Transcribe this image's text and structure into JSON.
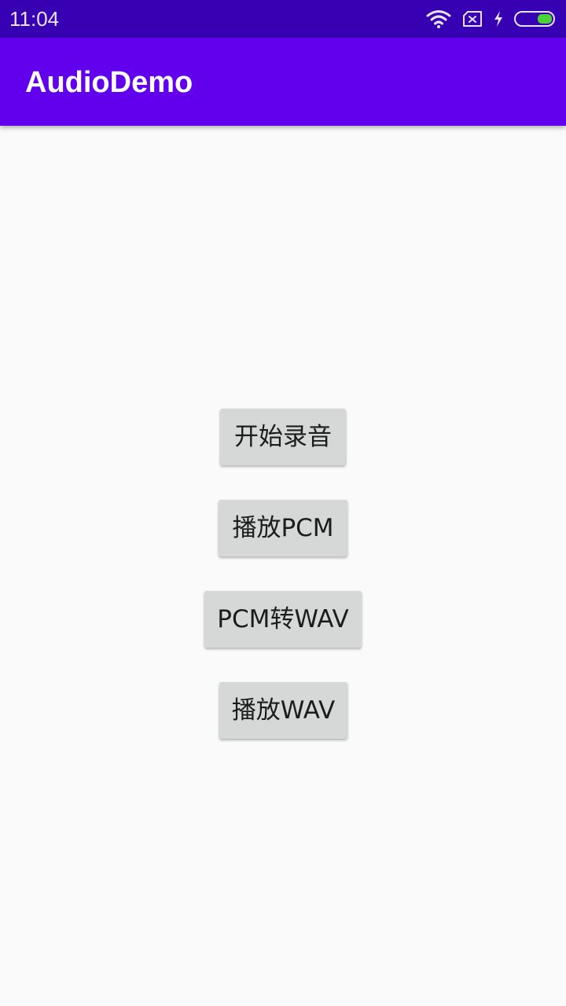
{
  "status_bar": {
    "time": "11:04",
    "icons": [
      "wifi-icon",
      "sim-x-icon",
      "charging-bolt-icon",
      "battery-icon"
    ],
    "battery_color": "#4cd137"
  },
  "app_bar": {
    "title": "AudioDemo",
    "color": "#6200ee"
  },
  "buttons": {
    "record": "开始录音",
    "play_pcm": "播放PCM",
    "pcm_to_wav": "PCM转WAV",
    "play_wav": "播放WAV"
  }
}
